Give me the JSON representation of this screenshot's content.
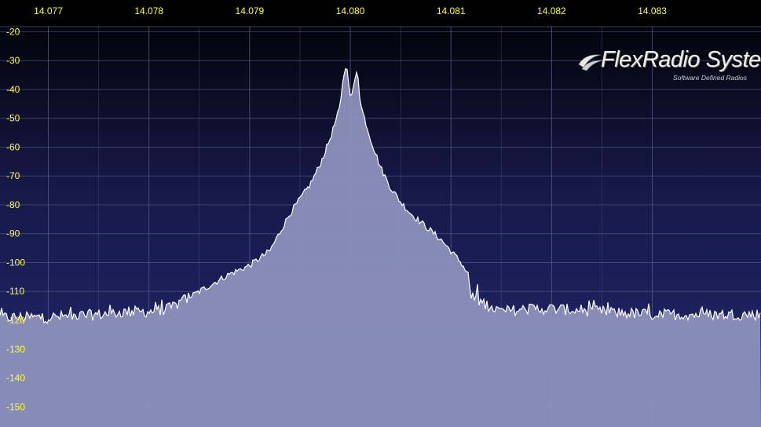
{
  "app": {
    "logo_text": "FlexRadio Systems",
    "logo_registered": "®",
    "logo_tagline": "Software Defined Radios"
  },
  "colors": {
    "background_top": "#000000",
    "background_mid": "#17194a",
    "background_bottom": "#22286e",
    "spectrum_fill": "#8f93bd",
    "spectrum_line": "#ffffff",
    "tick_label": "#ffff33",
    "grid": "#5a5e8a"
  },
  "chart_data": {
    "type": "area",
    "title": "",
    "xlabel": "",
    "ylabel": "",
    "x_unit": "MHz",
    "y_unit": "dBm",
    "xlim": [
      14.07652,
      14.08408
    ],
    "ylim": [
      -157,
      -9
    ],
    "x_ticks": [
      "14.077",
      "14.078",
      "14.079",
      "14.080",
      "14.081",
      "14.082",
      "14.083"
    ],
    "y_ticks": [
      "-20",
      "-30",
      "-40",
      "-50",
      "-60",
      "-70",
      "-80",
      "-90",
      "-100",
      "-110",
      "-120",
      "-130",
      "-140",
      "-150"
    ],
    "grid": true,
    "series": [
      {
        "x": [
          14.0765,
          14.077,
          14.0775,
          14.0778,
          14.078,
          14.0782,
          14.0785,
          14.0788,
          14.079,
          14.0792,
          14.0794,
          14.0796,
          14.0797,
          14.0798,
          14.0799,
          14.07993,
          14.07997,
          14.08,
          14.08003,
          14.08007,
          14.0801,
          14.0802,
          14.0803,
          14.0804,
          14.0805,
          14.0806,
          14.0807,
          14.0808,
          14.0809,
          14.081,
          14.0811,
          14.08117,
          14.0812,
          14.0815,
          14.0818,
          14.082,
          14.0825,
          14.083,
          14.0835,
          14.0841
        ],
        "values": [
          -119,
          -119,
          -118,
          -117,
          -117,
          -116,
          -110,
          -104,
          -101,
          -96,
          -83,
          -73,
          -66,
          -57,
          -46,
          -35,
          -32,
          -43,
          -40,
          -32,
          -45,
          -57,
          -67,
          -74,
          -79,
          -83,
          -86,
          -89,
          -92,
          -96,
          -100,
          -104,
          -112,
          -117,
          -116,
          -116,
          -117,
          -118,
          -118,
          -118
        ]
      }
    ]
  }
}
